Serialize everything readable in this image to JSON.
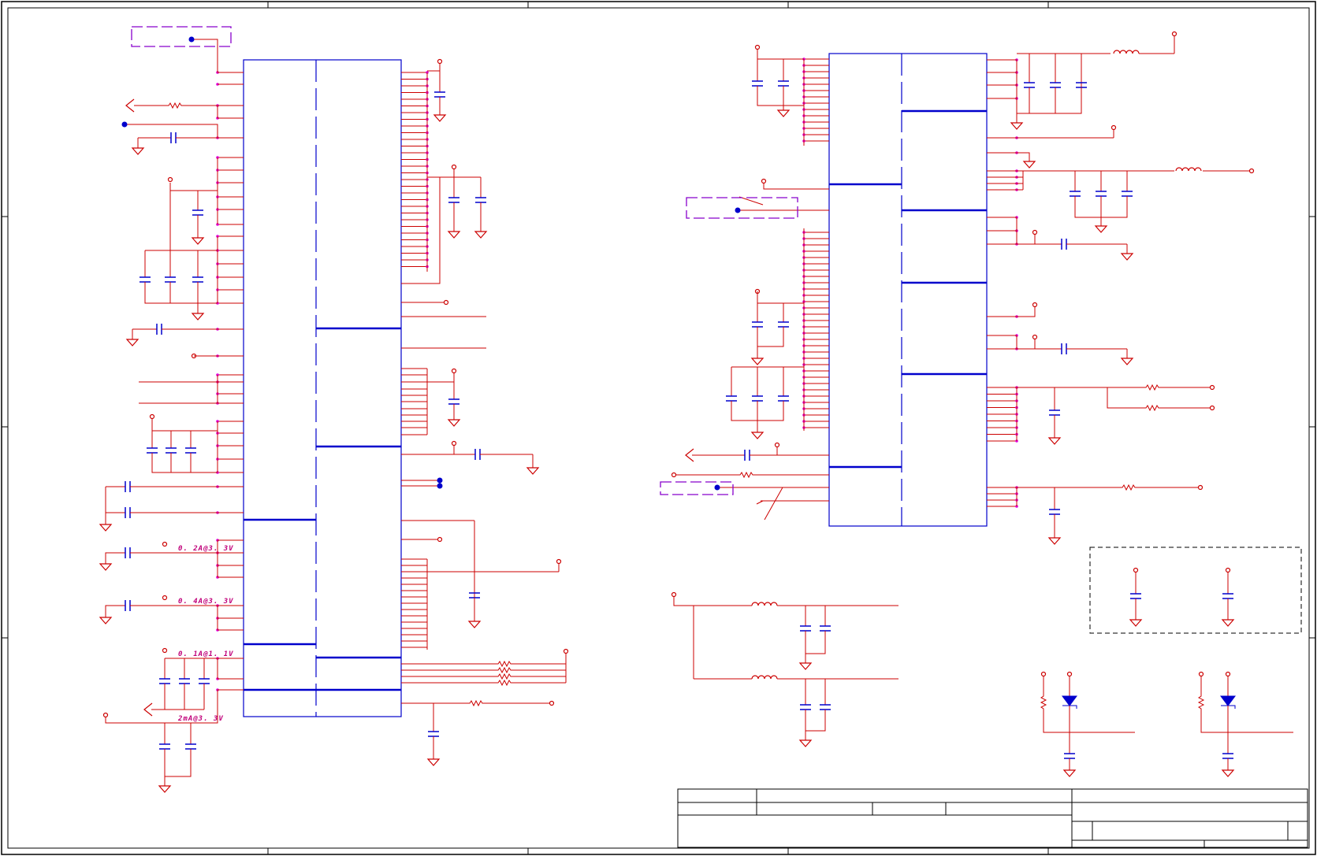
{
  "sheet": {
    "frame_color": "#000000",
    "wire_color": "#cc0000",
    "net_color": "#99004c",
    "body_color": "#0000cc",
    "pin_dot_color": "#e000e0",
    "keepout_color": "#8800cc"
  },
  "annotations": {
    "current_a": "0. 2A@3. 3V",
    "current_b": "0. 4A@3. 3V",
    "current_c": "0. 1A@1. 1V",
    "current_d": "2mA@3. 3V"
  },
  "symbols": {
    "ground": "ground-icon",
    "power_port": "power-port-icon",
    "capacitor": "capacitor-icon",
    "resistor": "resistor-icon",
    "inductor": "inductor-icon",
    "diode": "diode-icon",
    "test_point": "test-point-icon"
  }
}
